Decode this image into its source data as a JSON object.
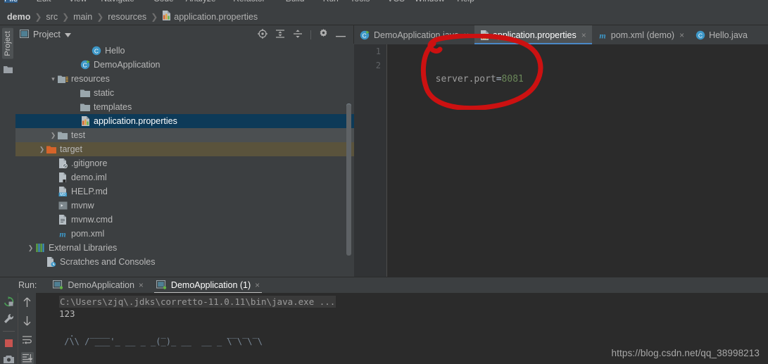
{
  "window": {
    "menubar_items": [
      "File",
      "Edit",
      "View",
      "Navigate",
      "Code",
      "Analyze",
      "Refactor",
      "Build",
      "Run",
      "Tools",
      "VCS",
      "Window",
      "Help"
    ]
  },
  "breadcrumb": {
    "items": [
      {
        "label": "demo",
        "icon": "",
        "root": true
      },
      {
        "label": "src",
        "icon": ""
      },
      {
        "label": "main",
        "icon": ""
      },
      {
        "label": "resources",
        "icon": ""
      },
      {
        "label": "application.properties",
        "icon": "properties-file-icon"
      }
    ],
    "separator": "❯"
  },
  "left_tool_strip": {
    "project_label": "Project",
    "folder_icon": "folder-icon"
  },
  "project_panel": {
    "title": "Project",
    "dropdown_icon": "chevron-down-icon",
    "actions": [
      {
        "name": "locate-icon",
        "title": "Select Opened File"
      },
      {
        "name": "expand-all-icon",
        "title": "Expand All"
      },
      {
        "name": "collapse-all-icon",
        "title": "Collapse All"
      },
      {
        "name": "gear-icon",
        "title": "Settings"
      },
      {
        "name": "minimize-icon",
        "title": "Hide"
      }
    ],
    "tree": [
      {
        "label": "Hello",
        "icon": "class-icon",
        "indent": 6,
        "arrow": "",
        "state": "normal"
      },
      {
        "label": "DemoApplication",
        "icon": "class-run-icon",
        "indent": 5,
        "arrow": "",
        "state": "normal"
      },
      {
        "label": "resources",
        "icon": "resources-folder-icon",
        "indent": 3,
        "arrow": "▾",
        "state": "normal"
      },
      {
        "label": "static",
        "icon": "folder-icon",
        "indent": 5,
        "arrow": "",
        "state": "normal"
      },
      {
        "label": "templates",
        "icon": "folder-icon",
        "indent": 5,
        "arrow": "",
        "state": "normal"
      },
      {
        "label": "application.properties",
        "icon": "properties-file-icon",
        "indent": 5,
        "arrow": "",
        "state": "selected"
      },
      {
        "label": "test",
        "icon": "folder-icon",
        "indent": 3,
        "arrow": "❯",
        "state": "hovered"
      },
      {
        "label": "target",
        "icon": "folder-excluded-icon",
        "indent": 2,
        "arrow": "❯",
        "state": "excluded"
      },
      {
        "label": ".gitignore",
        "icon": "gitignore-icon",
        "indent": 3,
        "arrow": "",
        "state": "normal"
      },
      {
        "label": "demo.iml",
        "icon": "iml-file-icon",
        "indent": 3,
        "arrow": "",
        "state": "normal"
      },
      {
        "label": "HELP.md",
        "icon": "markdown-file-icon",
        "indent": 3,
        "arrow": "",
        "state": "normal"
      },
      {
        "label": "mvnw",
        "icon": "script-file-icon",
        "indent": 3,
        "arrow": "",
        "state": "normal"
      },
      {
        "label": "mvnw.cmd",
        "icon": "text-file-icon",
        "indent": 3,
        "arrow": "",
        "state": "normal"
      },
      {
        "label": "pom.xml",
        "icon": "maven-file-icon",
        "indent": 3,
        "arrow": "",
        "state": "normal"
      },
      {
        "label": "External Libraries",
        "icon": "libraries-icon",
        "indent": 1,
        "arrow": "❯",
        "state": "normal"
      },
      {
        "label": "Scratches and Consoles",
        "icon": "scratches-icon",
        "indent": 2,
        "arrow": "",
        "state": "normal"
      }
    ]
  },
  "editor": {
    "tabs": [
      {
        "label": "DemoApplication.java",
        "icon": "class-run-icon",
        "active": false,
        "close": "×"
      },
      {
        "label": "application.properties",
        "icon": "properties-file-icon",
        "active": true,
        "close": "×"
      },
      {
        "label": "pom.xml (demo)",
        "icon": "maven-file-icon",
        "active": false,
        "close": "×"
      },
      {
        "label": "Hello.java",
        "icon": "class-icon",
        "active": false,
        "close": ""
      }
    ],
    "line_numbers": [
      "1",
      "2"
    ],
    "code": {
      "key": "server.port",
      "equals": "=",
      "value": "8081"
    }
  },
  "run_panel": {
    "label": "Run:",
    "tabs": [
      {
        "label": "DemoApplication",
        "icon": "run-config-icon",
        "active": false,
        "close": "×"
      },
      {
        "label": "DemoApplication (1)",
        "icon": "run-config-icon",
        "active": true,
        "close": "×"
      }
    ],
    "tools_left": [
      {
        "name": "rerun-icon"
      },
      {
        "name": "wrench-icon"
      },
      {
        "name": "divider"
      },
      {
        "name": "stop-icon"
      },
      {
        "name": "camera-icon"
      }
    ],
    "tools_right": [
      {
        "name": "arrow-up-icon"
      },
      {
        "name": "arrow-down-icon"
      },
      {
        "name": "soft-wrap-icon"
      },
      {
        "name": "scroll-to-end-icon"
      }
    ],
    "console": {
      "command": "C:\\Users\\zjq\\.jdks\\corretto-11.0.11\\bin\\java.exe ...",
      "output": "123",
      "banner_line1": "  .   ____          _            __ _ _",
      "banner_line2": " /\\\\ / ___'_ __ _ _(_)_ __  __ _ \\ \\ \\ \\"
    }
  },
  "annotation": {
    "shape": "hand-drawn-ellipse",
    "color": "#cc1111"
  },
  "watermark": {
    "text": "https://blog.csdn.net/qq_38998213"
  },
  "colors": {
    "background": "#3c3f41",
    "editor_background": "#2b2b2b",
    "selection": "#0d3a58",
    "excluded": "#5a533c",
    "accent": "#4a88c7",
    "annotation_red": "#cc1111",
    "string_green": "#6a8759"
  }
}
